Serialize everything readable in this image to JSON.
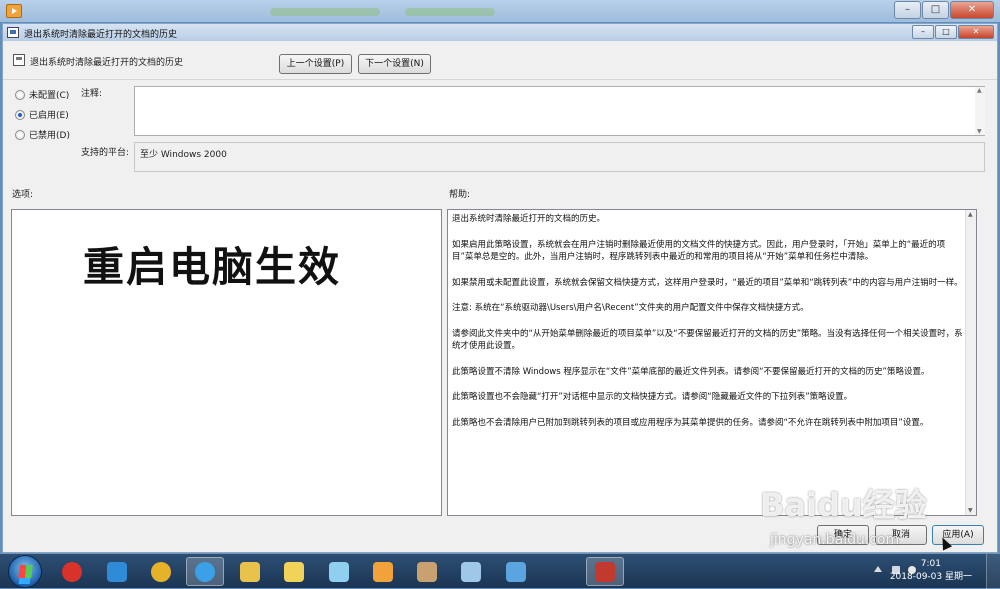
{
  "outer_window": {
    "icon": "media-player-icon",
    "controls": [
      "minimize",
      "maximize",
      "close"
    ]
  },
  "dialog": {
    "title": "退出系统时清除最近打开的文档的历史",
    "policy_name": "退出系统时清除最近打开的文档的历史",
    "prev_button": "上一个设置(P)",
    "next_button": "下一个设置(N)",
    "radios": [
      {
        "label": "未配置(C)",
        "checked": false
      },
      {
        "label": "已启用(E)",
        "checked": true
      },
      {
        "label": "已禁用(D)",
        "checked": false
      }
    ],
    "comment_label": "注释:",
    "comment_value": "",
    "platform_label": "支持的平台:",
    "platform_value": "至少 Windows 2000",
    "options_label": "选项:",
    "help_label": "帮助:",
    "overlay_text": "重启电脑生效",
    "help_paragraphs": [
      "退出系统时清除最近打开的文档的历史。",
      "如果启用此策略设置，系统就会在用户注销时删除最近使用的文档文件的快捷方式。因此，用户登录时，「开始」菜单上的“最近的项目”菜单总是空的。此外，当用户注销时，程序跳转列表中最近的和常用的项目将从“开始”菜单和任务栏中清除。",
      "如果禁用或未配置此设置，系统就会保留文档快捷方式，这样用户登录时，“最近的项目”菜单和“跳转列表”中的内容与用户注销时一样。",
      "注意: 系统在“系统驱动器\\Users\\用户名\\Recent”文件夹的用户配置文件中保存文档快捷方式。",
      "请参阅此文件夹中的“从开始菜单删除最近的项目菜单”以及“不要保留最近打开的文档的历史”策略。当没有选择任何一个相关设置时，系统才使用此设置。",
      "此策略设置不清除 Windows 程序显示在“文件”菜单底部的最近文件列表。请参阅“不要保留最近打开的文档的历史”策略设置。",
      "此策略设置也不会隐藏“打开”对话框中显示的文档快捷方式。请参阅“隐藏最近文件的下拉列表”策略设置。",
      "此策略也不会清除用户已附加到跳转列表的项目或应用程序为其菜单提供的任务。请参阅“不允许在跳转列表中附加项目”设置。"
    ],
    "ok_button": "确定",
    "cancel_button": "取消",
    "apply_button": "应用(A)"
  },
  "watermark": {
    "logo": "Baidu经验",
    "url": "jingyan.baidu.com"
  },
  "taskbar": {
    "icons": [
      {
        "name": "jiang-app-icon",
        "color": "#d8322a"
      },
      {
        "name": "ie-icon",
        "color": "#2f8ad8"
      },
      {
        "name": "chrome-icon",
        "color": "#e5b22a"
      },
      {
        "name": "qq-browser-icon",
        "color": "#3aa0e8"
      },
      {
        "name": "folder-icon",
        "color": "#e8c24a"
      },
      {
        "name": "notes-icon",
        "color": "#f1d35a"
      },
      {
        "name": "pinwheel-icon",
        "color": "#8fd0f0"
      },
      {
        "name": "media-player-icon",
        "color": "#f2a23a"
      },
      {
        "name": "paint-icon",
        "color": "#c9a070"
      },
      {
        "name": "network-icon",
        "color": "#9fc7e8"
      },
      {
        "name": "cube-icon",
        "color": "#5aa5e0"
      },
      {
        "name": "toolbox-icon",
        "color": "#c23a2e"
      }
    ],
    "clock_time": "7:01",
    "clock_date": "2018-09-03 星期一"
  }
}
